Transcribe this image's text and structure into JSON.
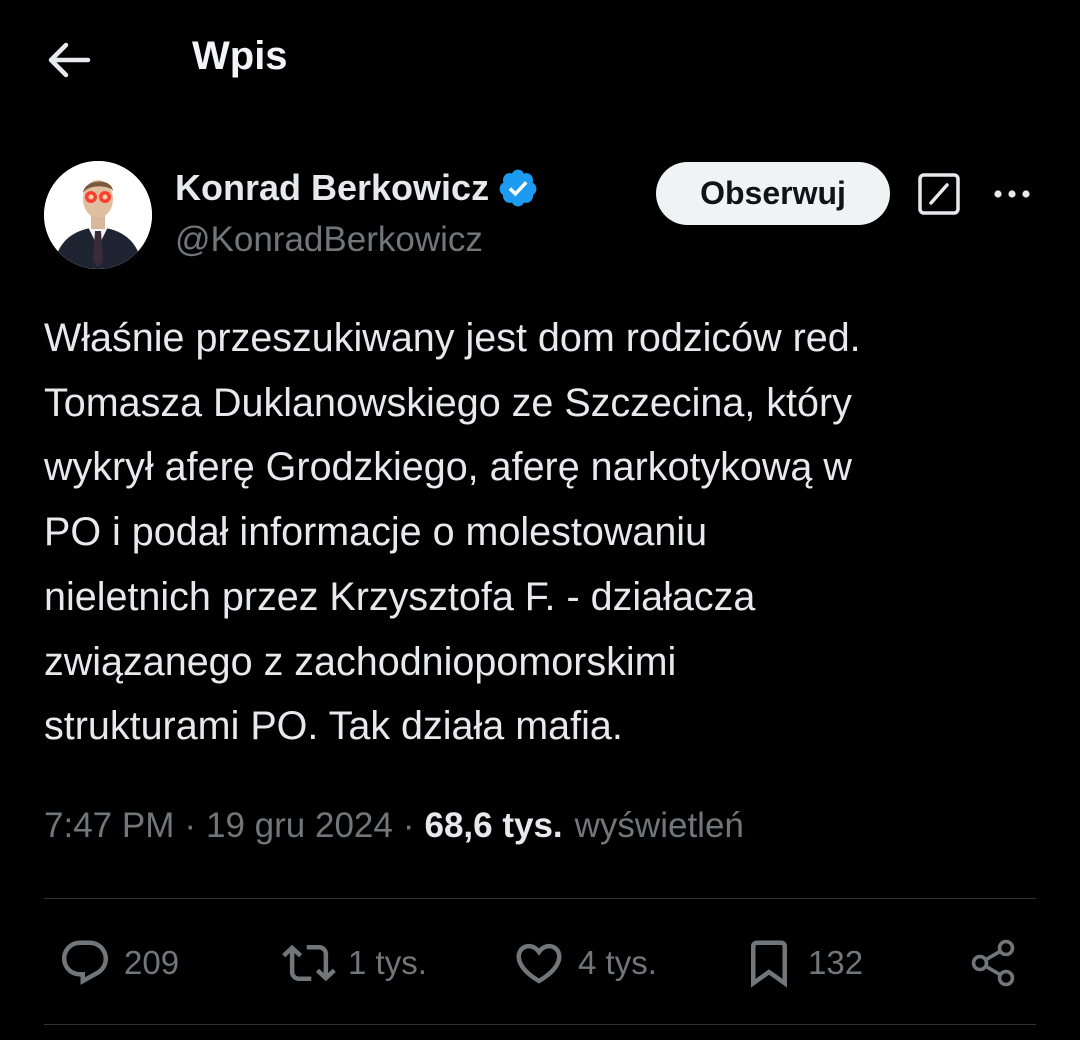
{
  "header": {
    "back_icon": "arrow-left-icon",
    "title": "Wpis"
  },
  "author": {
    "name": "Konrad Berkowicz",
    "handle": "@KonradBerkowicz",
    "verified_icon": "verified-badge-icon",
    "verified_color": "#1d9bf0"
  },
  "actions_top": {
    "follow_label": "Obserwuj",
    "grok_icon": "grok-icon",
    "more_icon": "more-horizontal-icon"
  },
  "tweet": {
    "text": "Właśnie przeszukiwany jest dom rodziców red.\nTomasza Duklanowskiego ze Szczecina, który\nwykrył aferę Grodzkiego, aferę narkotykową w\nPO i podał informacje o molestowaniu\nnieletnich przez Krzysztofa F. - działacza\nzwiązanego z zachodniopomorskimi\nstrukturami PO. Tak działa mafia."
  },
  "meta": {
    "time": "7:47 PM",
    "separator": "·",
    "date": "19 gru 2024",
    "views_count": "68,6 tys.",
    "views_label": "wyświetleń"
  },
  "actions": {
    "reply": {
      "icon": "reply-icon",
      "count": "209"
    },
    "retweet": {
      "icon": "retweet-icon",
      "count": "1 tys."
    },
    "like": {
      "icon": "heart-icon",
      "count": "4 tys."
    },
    "bookmark": {
      "icon": "bookmark-icon",
      "count": "132"
    },
    "share": {
      "icon": "share-icon"
    }
  },
  "colors": {
    "background": "#000000",
    "text_primary": "#e7e9ea",
    "text_secondary": "#71767b",
    "follow_bg": "#eff3f4",
    "divider": "#2f3336"
  }
}
